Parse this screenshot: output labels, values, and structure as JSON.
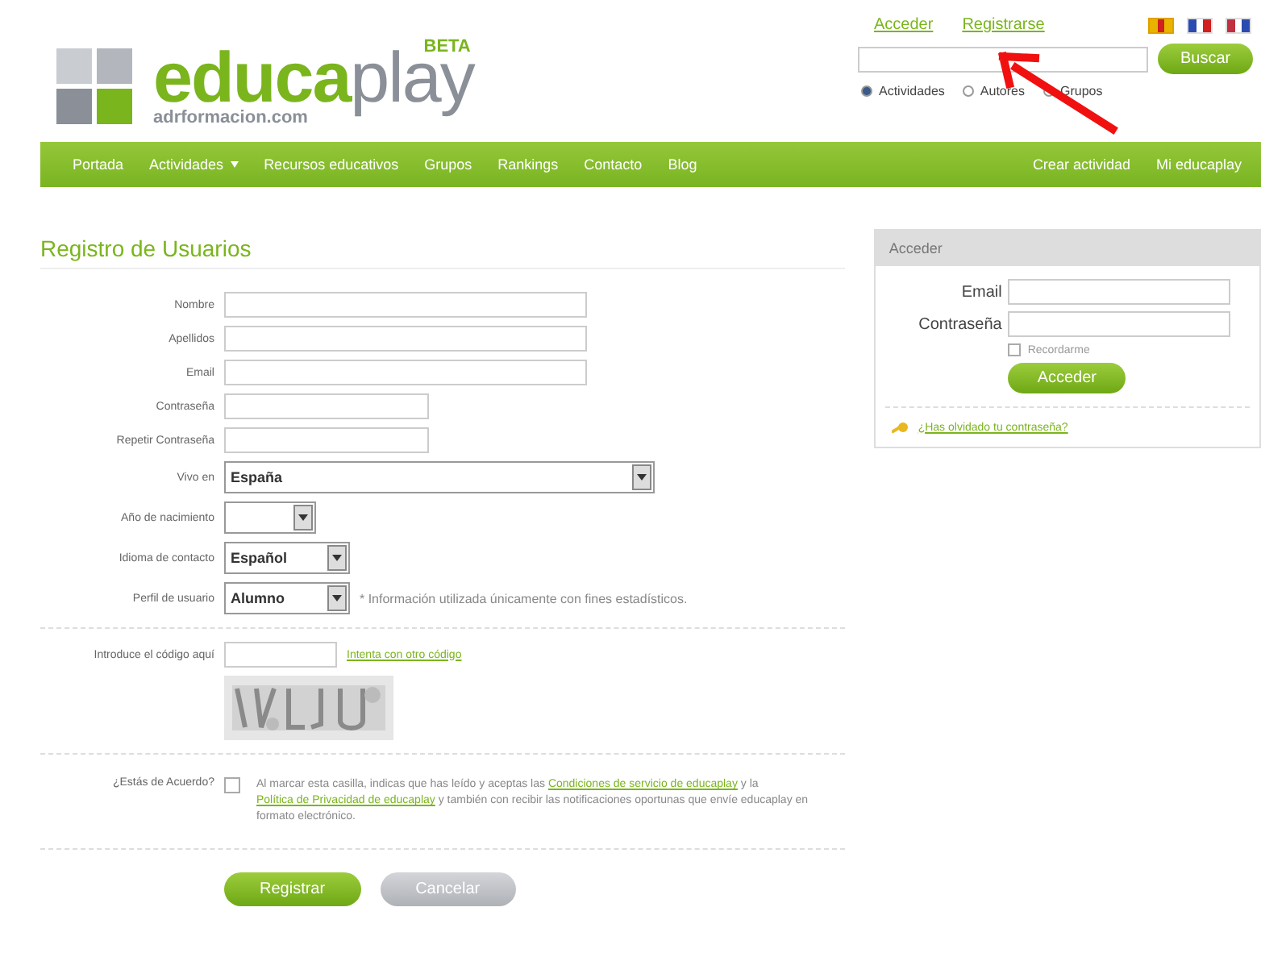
{
  "top_links": [
    {
      "label": "Acceder"
    },
    {
      "label": "Registrarse"
    }
  ],
  "languages": [
    {
      "selected": true
    },
    {
      "selected": false
    },
    {
      "selected": false
    }
  ],
  "logo": {
    "brand_a": "educa",
    "brand_b": "play",
    "badge": "BETA",
    "subtitle": "adrformacion.com"
  },
  "search": {
    "button": "Buscar",
    "options": [
      {
        "label": "Actividades",
        "selected": true
      },
      {
        "label": "Autores",
        "selected": false
      },
      {
        "label": "Grupos",
        "selected": false
      }
    ]
  },
  "nav": {
    "left": [
      {
        "label": "Portada",
        "dropdown": false
      },
      {
        "label": "Actividades",
        "dropdown": true
      },
      {
        "label": "Recursos educativos",
        "dropdown": false
      },
      {
        "label": "Grupos",
        "dropdown": false
      },
      {
        "label": "Rankings",
        "dropdown": false
      },
      {
        "label": "Contacto",
        "dropdown": false
      },
      {
        "label": "Blog",
        "dropdown": false
      }
    ],
    "right": [
      "Crear actividad",
      "Mi educaplay"
    ]
  },
  "form": {
    "title": "Registro de Usuarios",
    "fields": [
      {
        "label": "Nombre",
        "kind": "text"
      },
      {
        "label": "Apellidos",
        "kind": "text"
      },
      {
        "label": "Email",
        "kind": "text"
      },
      {
        "label": "Contraseña",
        "kind": "text"
      },
      {
        "label": "Repetir Contraseña",
        "kind": "text"
      },
      {
        "label": "Vivo en",
        "kind": "select",
        "value": "España"
      },
      {
        "label": "Año de nacimiento",
        "kind": "select"
      },
      {
        "label": "Idioma de contacto",
        "kind": "select",
        "value": "Español"
      },
      {
        "label": "Perfil de usuario",
        "kind": "select",
        "value": "Alumno",
        "note": "* Información utilizada únicamente con fines estadísticos."
      }
    ],
    "captcha": {
      "label": "Introduce el código aquí",
      "link": "Intenta con otro código"
    },
    "agree": {
      "label": "¿Estás de Acuerdo?",
      "checked": false,
      "text_1": "Al marcar esta casilla, indicas que has leído y aceptas las ",
      "link_1": "Condiciones de servicio de educaplay",
      "text_2": " y la ",
      "link_2": "Política de Privacidad de educaplay",
      "text_3": " y también con recibir las notificaciones oportunas que envíe educaplay en formato electrónico."
    },
    "buttons": [
      {
        "label": "Registrar",
        "kind": "primary"
      },
      {
        "label": "Cancelar",
        "kind": "secondary"
      }
    ]
  },
  "login": {
    "title": "Acceder",
    "email_label": "Email",
    "password_label": "Contraseña",
    "remember": {
      "label": "Recordarme",
      "checked": false
    },
    "button": "Acceder",
    "forgot": "¿Has olvidado tu contraseña?"
  }
}
